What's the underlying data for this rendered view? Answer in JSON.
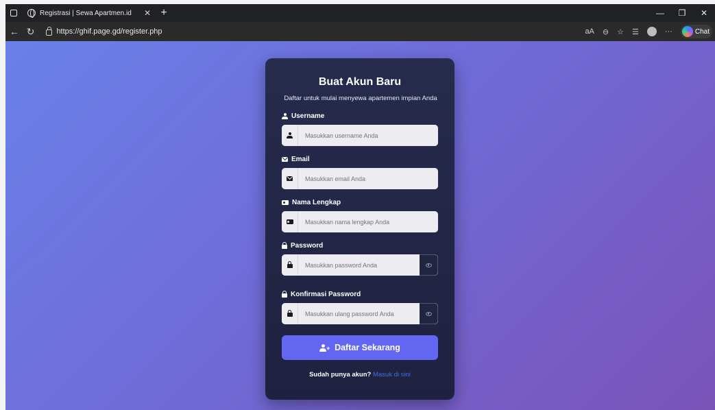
{
  "browser": {
    "tab_title": "Registrasi | Sewa Apartmen.id",
    "url": "https://ghif.page.gd/register.php",
    "copilot_label": "Chat",
    "read_aloud_label": "aA"
  },
  "form": {
    "title": "Buat Akun Baru",
    "subtitle": "Daftar untuk mulai menyewa apartemen impian Anda",
    "fields": {
      "username": {
        "label": "Username",
        "placeholder": "Masukkan username Anda"
      },
      "email": {
        "label": "Email",
        "placeholder": "Masukkan email Anda"
      },
      "fullname": {
        "label": "Nama Lengkap",
        "placeholder": "Masukkan nama lengkap Anda"
      },
      "password": {
        "label": "Password",
        "placeholder": "Masukkan password Anda"
      },
      "confirm": {
        "label": "Konfirmasi Password",
        "placeholder": "Masukkan ulang password Anda"
      }
    },
    "submit_label": "Daftar Sekarang",
    "login_prompt": "Sudah punya akun?",
    "login_link": "Masuk di sini"
  },
  "colors": {
    "card_bg": "#262a4a",
    "button": "#6366f1",
    "link": "#3f6ee8",
    "page_gradient_start": "#6a80ea",
    "page_gradient_end": "#7a53b8"
  }
}
